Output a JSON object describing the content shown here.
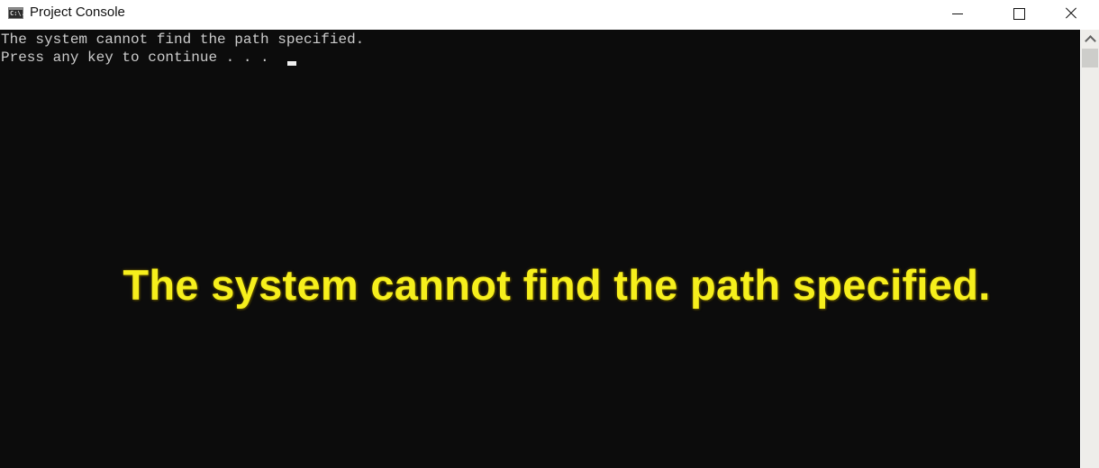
{
  "window": {
    "title": "Project Console",
    "app_icon": "console-app-icon",
    "app_icon_text": "C:\\.",
    "controls": {
      "minimize": "minimize-icon",
      "maximize": "maximize-icon",
      "close": "close-icon"
    }
  },
  "console": {
    "lines": [
      "The system cannot find the path specified.",
      "Press any key to continue . . . "
    ],
    "background": "#0c0c0c",
    "text_color": "#cccccc"
  },
  "overlay_caption": {
    "text": "The system cannot find the path specified.",
    "color": "#f6ef1c"
  },
  "scrollbar": {
    "up_arrow": "chevron-up-icon"
  }
}
